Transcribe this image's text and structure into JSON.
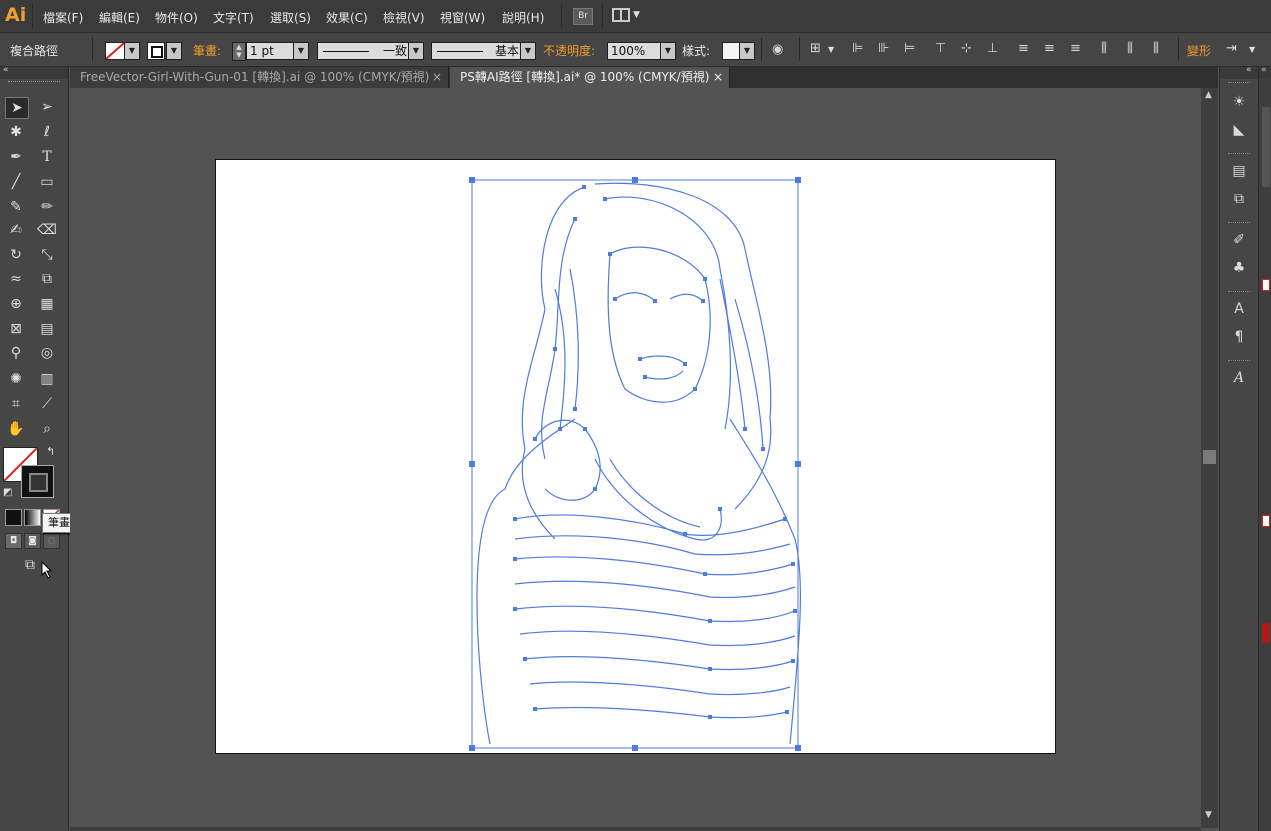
{
  "app": {
    "logo": "Ai"
  },
  "menu": {
    "items": [
      "檔案(F)",
      "編輯(E)",
      "物件(O)",
      "文字(T)",
      "選取(S)",
      "效果(C)",
      "檢視(V)",
      "視窗(W)",
      "說明(H)"
    ],
    "bridge_label": "Br"
  },
  "control_bar": {
    "selection_type": "複合路徑",
    "stroke_label": "筆畫:",
    "stroke_weight": "1 pt",
    "profile_label": "一致",
    "brush_label": "基本",
    "opacity_label": "不透明度:",
    "opacity_value": "100%",
    "style_label": "樣式:",
    "transform_label": "變形"
  },
  "tabs": [
    {
      "label": "FreeVector-Girl-With-Gun-01 [轉換].ai @ 100% (CMYK/預視)",
      "close": "×",
      "active": false
    },
    {
      "label": "PS轉AI路徑 [轉換].ai* @ 100% (CMYK/預視)",
      "close": "×",
      "active": true
    }
  ],
  "tooltip": {
    "text": "筆畫(X)"
  },
  "icons": {
    "selection": "selection-tool-icon",
    "direct_selection": "direct-selection-tool-icon",
    "pen": "pen-tool-icon",
    "type": "type-tool-icon"
  },
  "colors": {
    "accent_orange": "#f39a2a",
    "path_blue": "#4d7be0",
    "artboard": "#ffffff",
    "workspace": "#535353"
  }
}
